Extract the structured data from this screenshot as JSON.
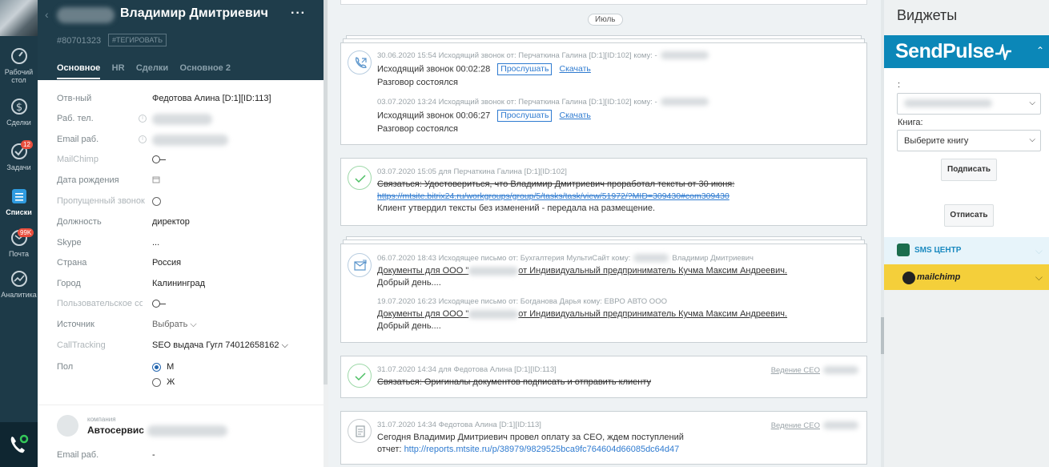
{
  "nav": {
    "items": [
      {
        "label": "Рабочий стол",
        "icon": "dashboard-icon"
      },
      {
        "label": "Сделки",
        "icon": "deals-icon"
      },
      {
        "label": "Задачи",
        "icon": "tasks-icon",
        "badge": "12"
      },
      {
        "label": "Списки",
        "icon": "lists-icon"
      },
      {
        "label": "Почта",
        "icon": "mail-icon",
        "badge": "99K"
      },
      {
        "label": "Аналитика",
        "icon": "analytics-icon"
      }
    ]
  },
  "card": {
    "name": "Владимир Дмитриевич",
    "id": "#80701323",
    "tag": "#ТЕГИРОВАТЬ",
    "more": "···",
    "tabs": [
      "Основное",
      "HR",
      "Сделки",
      "Основное 2"
    ],
    "fields": {
      "responsible": {
        "label": "Отв-ный",
        "value": "Федотова Алина [D:1][ID:113]"
      },
      "work_phone": {
        "label": "Раб. тел."
      },
      "work_email": {
        "label": "Email раб."
      },
      "mailchimp": {
        "label": "MailChimp"
      },
      "birthday": {
        "label": "Дата рождения"
      },
      "missed_call": {
        "label": "Пропущенный звонок"
      },
      "position": {
        "label": "Должность",
        "value": "директор"
      },
      "skype": {
        "label": "Skype",
        "value": "..."
      },
      "country": {
        "label": "Страна",
        "value": "Россия"
      },
      "city": {
        "label": "Город",
        "value": "Калининград"
      },
      "user_agreement": {
        "label": "Пользовательское соглашение"
      },
      "source": {
        "label": "Источник",
        "value": "Выбрать"
      },
      "calltracking": {
        "label": "CallTracking",
        "value": "SEO выдача Гугл 74012658162"
      },
      "gender": {
        "label": "Пол",
        "options": [
          "М",
          "Ж"
        ]
      }
    },
    "company": {
      "caption": "компания",
      "name": "Автосервис",
      "email_label": "Email раб.",
      "email_value": "-"
    }
  },
  "feed": {
    "month": "Июль",
    "calls": [
      {
        "meta": "30.06.2020 15:54 Исходящий звонок от: Перчаткина Галина [D:1][ID:102] кому: -",
        "text": "Исходящий звонок 00:02:28",
        "status": "Разговор состоялся"
      },
      {
        "meta": "03.07.2020 13:24 Исходящий звонок от: Перчаткина Галина [D:1][ID:102] кому: -",
        "text": "Исходящий звонок 00:06:27",
        "status": "Разговор состоялся"
      }
    ],
    "listen_label": "Прослушать",
    "download_label": "Скачать",
    "task1": {
      "meta": "03.07.2020 15:05  для Перчаткина Галина [D:1][ID:102]",
      "title": "Связаться: Удостовериться, что Владимир Дмитриевич проработал тексты от 30 июня:",
      "url": "https://mtsite.bitrix24.ru/workgroups/group/5/tasks/task/view/51972/?MID=309430#com309430",
      "result": "Клиент утвердил тексты без изменений - передала на размещение."
    },
    "emails": [
      {
        "meta_a": "06.07.2020 18:43 Исходящее письмо от: Бухгалтерия МультиСайт кому:",
        "meta_b": "Владимир Дмитриевич",
        "subject_a": "Документы для ООО \"",
        "subject_b": "от Индивидуальный предприниматель Кучма Максим Андреевич.",
        "body": "Добрый день...."
      },
      {
        "meta_a": "19.07.2020 16:23 Исходящее письмо от: Богданова Дарья кому: ЕВРО АВТО ООО",
        "meta_b": "",
        "subject_a": "Документы для ООО \"",
        "subject_b": "от Индивидуальный предприниматель Кучма Максим Андреевич.",
        "body": "Добрый день...."
      }
    ],
    "task2": {
      "meta": "31.07.2020 14:34  для Федотова Алина [D:1][ID:113]",
      "right": "Ведение СЕО",
      "title": "Связаться: Оригиналы документов подписать и отправить клиенту"
    },
    "note": {
      "meta": "31.07.2020 14:34 Федотова Алина [D:1][ID:113]",
      "right": "Ведение СЕО",
      "line1": "Сегодня Владимир Дмитриевич провел оплату за СЕО, ждем поступлений",
      "line2_label": "отчет:",
      "line2_url": "http://reports.mtsite.ru/p/38979/9829525bca9fc764604d66085dc64d47"
    }
  },
  "widgets": {
    "title": "Виджеты",
    "sendpulse": {
      "logo": "SendPulse",
      "colon_label": ":",
      "book_label": "Книга:",
      "book_value": "Выберите книгу",
      "subscribe": "Подписать",
      "unsubscribe": "Отписать"
    },
    "sms": {
      "label": "SMS ЦЕНТР"
    },
    "mailchimp": {
      "label": "mailchimp"
    }
  }
}
